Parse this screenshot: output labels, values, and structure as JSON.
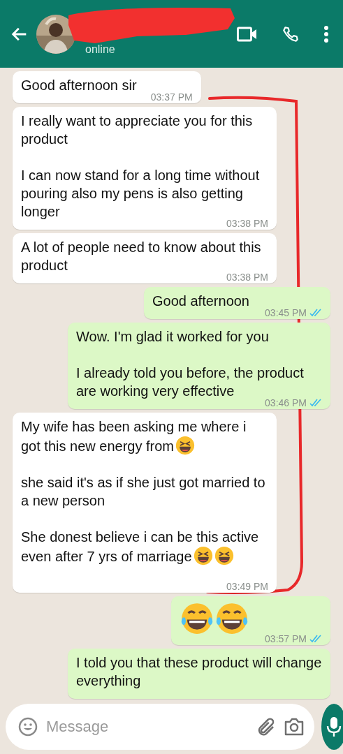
{
  "header": {
    "status": "online"
  },
  "messages": [
    {
      "kind": "incoming",
      "paragraphs": [
        {
          "text": "Good afternoon sir"
        }
      ],
      "time": "03:37 PM"
    },
    {
      "kind": "incoming",
      "paragraphs": [
        {
          "text": "I really want to appreciate you for this product"
        },
        {
          "text": "I can now stand for a long time without pouring also my pens is also getting longer"
        }
      ],
      "time": "03:38 PM"
    },
    {
      "kind": "incoming",
      "paragraphs": [
        {
          "text": "A lot of people need to know about this product"
        }
      ],
      "time": "03:38 PM"
    },
    {
      "kind": "outgoing",
      "paragraphs": [
        {
          "text": "Good afternoon"
        }
      ],
      "time": "03:45 PM",
      "read": true
    },
    {
      "kind": "outgoing",
      "paragraphs": [
        {
          "text": "Wow. I'm glad it worked for you"
        },
        {
          "text": "I already told you before, the product are working very effective"
        }
      ],
      "time": "03:46 PM",
      "read": true
    },
    {
      "kind": "incoming",
      "paragraphs": [
        {
          "text": "My wife has been asking me where i got this new energy from",
          "emojis": [
            {
              "kind": "grin-squint"
            }
          ]
        },
        {
          "text": "she said it's as if she just got married to a new person"
        },
        {
          "text": "She donest believe i can be this active even after 7 yrs of marriage",
          "emojis": [
            {
              "kind": "grin-squint"
            },
            {
              "kind": "grin-squint"
            }
          ]
        }
      ],
      "time": "03:49 PM"
    },
    {
      "kind": "outgoing",
      "paragraphs": [
        {
          "emojis": [
            {
              "kind": "tears-of-joy"
            },
            {
              "kind": "tears-of-joy"
            }
          ]
        }
      ],
      "time": "03:57 PM",
      "read": true
    },
    {
      "kind": "outgoing",
      "paragraphs": [
        {
          "text": "I told you that these product will change everything"
        }
      ]
    }
  ],
  "composer": {
    "placeholder": "Message"
  }
}
